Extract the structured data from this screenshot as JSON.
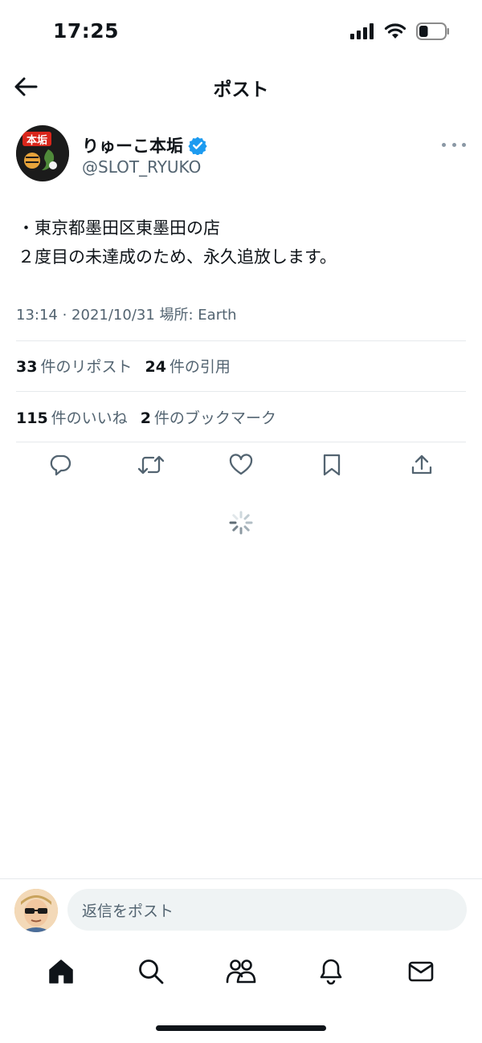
{
  "status_bar": {
    "time": "17:25",
    "battery_level": 0.35
  },
  "header": {
    "title": "ポスト",
    "back_icon": "arrow-left-icon"
  },
  "author": {
    "name": "りゅーこ本垢",
    "handle": "@SLOT_RYUKO",
    "verified": true,
    "verified_color": "#1d9bf0",
    "avatar_text": "本垢"
  },
  "post": {
    "lines": [
      "・東京都墨田区東墨田の店",
      "２度目の未達成のため、永久追放します。"
    ],
    "meta": "13:14 · 2021/10/31 場所: Earth"
  },
  "stats": {
    "reposts_count": "33",
    "reposts_label": "件のリポスト",
    "quotes_count": "24",
    "quotes_label": "件の引用",
    "likes_count": "115",
    "likes_label": "件のいいね",
    "bookmarks_count": "2",
    "bookmarks_label": "件のブックマーク"
  },
  "actions": [
    "reply-icon",
    "repost-icon",
    "like-icon",
    "bookmark-icon",
    "share-icon"
  ],
  "reply_bar": {
    "placeholder": "返信をポスト"
  },
  "tab_bar": [
    "home-icon",
    "search-icon",
    "communities-icon",
    "notifications-icon",
    "messages-icon"
  ],
  "colors": {
    "text": "#0f1419",
    "secondary": "#536471",
    "accent": "#1d9bf0",
    "divider": "#e6e9ec"
  }
}
